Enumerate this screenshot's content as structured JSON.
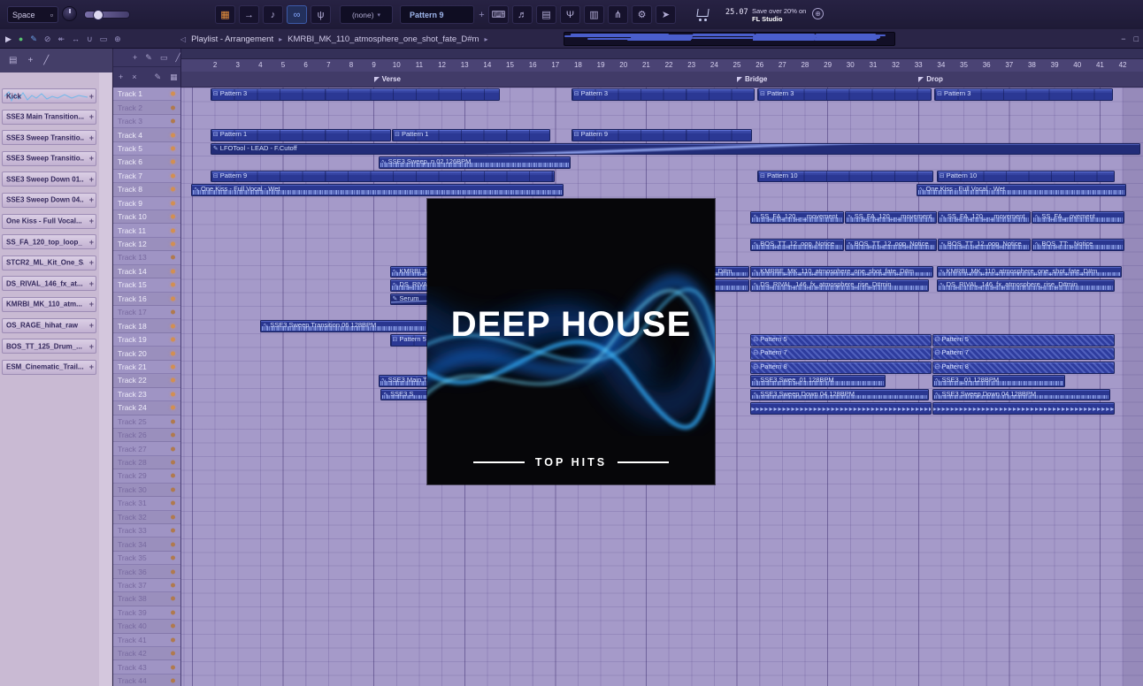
{
  "titlebar": {
    "space": "Space",
    "space_icon_glyph": "▫",
    "tool_icons": [
      {
        "name": "pattern-grid-icon",
        "glyph": "▦",
        "accent": true
      },
      {
        "name": "arrow-right-icon",
        "glyph": "→"
      },
      {
        "name": "note-icon",
        "glyph": "♪"
      },
      {
        "name": "link-icon",
        "glyph": "∞",
        "active": true
      },
      {
        "name": "mic-icon",
        "glyph": "ψ"
      }
    ],
    "instrument_selector": "(none)",
    "selector_caret": "▾",
    "pattern_selector": "Pattern 9",
    "pattern_add": "+",
    "right_icons": [
      {
        "name": "keyboard-icon",
        "glyph": "⌨"
      },
      {
        "name": "notes-icon",
        "glyph": "♬"
      },
      {
        "name": "grid-icon",
        "glyph": "▤"
      },
      {
        "name": "metronome-icon",
        "glyph": "Ψ"
      },
      {
        "name": "panels-icon",
        "glyph": "▥"
      },
      {
        "name": "splitter-icon",
        "glyph": "⋔"
      },
      {
        "name": "gear-icon",
        "glyph": "⚙"
      },
      {
        "name": "pointer-icon",
        "glyph": "➤"
      }
    ],
    "globe_glyph": "⊕",
    "time": "25.07",
    "promo_line1": "Save over 20% on",
    "promo_line2": "FL Studio"
  },
  "toolbar2": {
    "left_icons": [
      {
        "name": "play-icon",
        "glyph": "▶",
        "color": "#cfcae8"
      },
      {
        "name": "record-dot-icon",
        "glyph": "●",
        "color": "#58c470"
      },
      {
        "name": "draw-icon",
        "glyph": "✎",
        "color": "#6aa0e8"
      },
      {
        "name": "slip-icon",
        "glyph": "⊘",
        "color": "#9a93c4"
      },
      {
        "name": "rewind-icon",
        "glyph": "↞",
        "color": "#9a93c4"
      },
      {
        "name": "pan-icon",
        "glyph": "↔",
        "color": "#9a93c4"
      },
      {
        "name": "magnet-icon",
        "glyph": "∪",
        "color": "#9a93c4"
      },
      {
        "name": "select-icon",
        "glyph": "▭",
        "color": "#9a93c4"
      },
      {
        "name": "zoom-icon",
        "glyph": "⊕",
        "color": "#9a93c4"
      }
    ],
    "speaker_glyph": "◁",
    "breadcrumb": "Playlist - Arrangement",
    "sep": "▸",
    "file": "KMRBI_MK_110_atmosphere_one_shot_fate_D#m",
    "minimize": "−",
    "restore": "□"
  },
  "browser": {
    "toolbar_icons": [
      {
        "name": "menu-icon",
        "glyph": "▤"
      },
      {
        "name": "add-icon",
        "glyph": "+"
      },
      {
        "name": "filter-icon",
        "glyph": "╱"
      }
    ],
    "handle_glyph": "+",
    "items": [
      {
        "label": "Kick",
        "waveform": true
      },
      {
        "label": "SSE3 Main Transition...",
        "waveform": false
      },
      {
        "label": "SSE3 Sweep Transitio...",
        "waveform": false
      },
      {
        "label": "SSE3 Sweep Transitio...",
        "waveform": false
      },
      {
        "label": "SSE3 Sweep Down 01...",
        "waveform": false
      },
      {
        "label": "SSE3 Sweep Down 04...",
        "waveform": false
      },
      {
        "label": "One Kiss - Full Vocal...",
        "waveform": false
      },
      {
        "label": "SS_FA_120_top_loop_",
        "waveform": false
      },
      {
        "label": "STCR2_ML_Kit_One_S...",
        "waveform": false
      },
      {
        "label": "DS_RIVAL_146_fx_at...",
        "waveform": false
      },
      {
        "label": "KMRBI_MK_110_atm...",
        "waveform": false
      },
      {
        "label": "OS_RAGE_hihat_raw",
        "waveform": false
      },
      {
        "label": "BOS_TT_125_Drum_...",
        "waveform": false
      },
      {
        "label": "ESM_Cinematic_Trail...",
        "waveform": false
      }
    ]
  },
  "playlist_tools": {
    "icons": [
      {
        "name": "select-tool-icon",
        "glyph": "+"
      },
      {
        "name": "draw-tool-icon",
        "glyph": "✎"
      },
      {
        "name": "paint-tool-icon",
        "glyph": "▭"
      },
      {
        "name": "slice-tool-icon",
        "glyph": "╱"
      }
    ]
  },
  "track_header": {
    "icons_left": [
      {
        "name": "add-track-icon",
        "glyph": "+"
      },
      {
        "name": "delete-track-icon",
        "glyph": "×"
      }
    ],
    "icons_right": [
      {
        "name": "pencil-icon",
        "glyph": "✎"
      },
      {
        "name": "grid-small-icon",
        "glyph": "▦"
      }
    ]
  },
  "timeline": {
    "first_bar": 2,
    "last_bar": 42,
    "markers": [
      {
        "label": "Verse",
        "bar": 9
      },
      {
        "label": "Bridge",
        "bar": 25
      },
      {
        "label": "Drop",
        "bar": 33
      }
    ]
  },
  "clip_icons": {
    "pattern": "⊟",
    "pattern-dim": "⊟",
    "audio": "∿",
    "automation": "✎",
    "chopped": ""
  },
  "chop_glyph": "▸",
  "tracks": [
    {
      "name": "Track 1",
      "active": true
    },
    {
      "name": "Track 2",
      "active": false
    },
    {
      "name": "Track 3",
      "active": false
    },
    {
      "name": "Track 4",
      "active": true
    },
    {
      "name": "Track 5",
      "active": true
    },
    {
      "name": "Track 6",
      "active": true
    },
    {
      "name": "Track 7",
      "active": true
    },
    {
      "name": "Track 8",
      "active": true
    },
    {
      "name": "Track 9",
      "active": true
    },
    {
      "name": "Track 10",
      "active": true
    },
    {
      "name": "Track 11",
      "active": true
    },
    {
      "name": "Track 12",
      "active": true
    },
    {
      "name": "Track 13",
      "active": false
    },
    {
      "name": "Track 14",
      "active": true
    },
    {
      "name": "Track 15",
      "active": true
    },
    {
      "name": "Track 16",
      "active": true
    },
    {
      "name": "Track 17",
      "active": false
    },
    {
      "name": "Track 18",
      "active": true
    },
    {
      "name": "Track 19",
      "active": true
    },
    {
      "name": "Track 20",
      "active": true
    },
    {
      "name": "Track 21",
      "active": true
    },
    {
      "name": "Track 22",
      "active": true
    },
    {
      "name": "Track 23",
      "active": true
    },
    {
      "name": "Track 24",
      "active": true
    },
    {
      "name": "Track 25",
      "active": false
    },
    {
      "name": "Track 26",
      "active": false
    },
    {
      "name": "Track 27",
      "active": false
    },
    {
      "name": "Track 28",
      "active": false
    },
    {
      "name": "Track 29",
      "active": false
    },
    {
      "name": "Track 30",
      "active": false
    },
    {
      "name": "Track 31",
      "active": false
    },
    {
      "name": "Track 32",
      "active": false
    },
    {
      "name": "Track 33",
      "active": false
    },
    {
      "name": "Track 34",
      "active": false
    },
    {
      "name": "Track 35",
      "active": false
    },
    {
      "name": "Track 36",
      "active": false
    },
    {
      "name": "Track 37",
      "active": false
    },
    {
      "name": "Track 38",
      "active": false
    },
    {
      "name": "Track 39",
      "active": false
    },
    {
      "name": "Track 40",
      "active": false
    },
    {
      "name": "Track 41",
      "active": false
    },
    {
      "name": "Track 42",
      "active": false
    },
    {
      "name": "Track 43",
      "active": false
    },
    {
      "name": "Track 44",
      "active": false
    }
  ],
  "clips": [
    {
      "track": 1,
      "start": 1.8,
      "end": 14.6,
      "label": "Pattern 3",
      "kind": "pattern"
    },
    {
      "track": 1,
      "start": 17.7,
      "end": 25.8,
      "label": "Pattern 3",
      "kind": "pattern"
    },
    {
      "track": 1,
      "start": 25.9,
      "end": 33.6,
      "label": "Pattern 3",
      "kind": "pattern"
    },
    {
      "track": 1,
      "start": 33.7,
      "end": 41.6,
      "label": "Pattern 3",
      "kind": "pattern"
    },
    {
      "track": 4,
      "start": 1.8,
      "end": 9.8,
      "label": "Pattern 1",
      "kind": "pattern"
    },
    {
      "track": 4,
      "start": 9.8,
      "end": 16.8,
      "label": "Pattern 1",
      "kind": "pattern"
    },
    {
      "track": 4,
      "start": 17.7,
      "end": 25.7,
      "label": "Pattern 9",
      "kind": "pattern"
    },
    {
      "track": 5,
      "start": 1.8,
      "end": 42.8,
      "label": "LFOTool - LEAD - F.Cutoff",
      "kind": "automation"
    },
    {
      "track": 6,
      "start": 9.2,
      "end": 17.7,
      "label": "SSE3 Sweep..n 02 126BPM",
      "kind": "audio"
    },
    {
      "track": 7,
      "start": 1.8,
      "end": 17.0,
      "label": "Pattern 9",
      "kind": "pattern"
    },
    {
      "track": 7,
      "start": 25.9,
      "end": 33.7,
      "label": "Pattern 10",
      "kind": "pattern"
    },
    {
      "track": 7,
      "start": 33.8,
      "end": 41.7,
      "label": "Pattern 10",
      "kind": "pattern"
    },
    {
      "track": 8,
      "start": 0.95,
      "end": 17.4,
      "label": "One Kiss - Full Vocal - Wet",
      "kind": "audio"
    },
    {
      "track": 8,
      "start": 32.9,
      "end": 42.2,
      "label": "One Kiss - Full Vocal - Wet",
      "kind": "audio"
    },
    {
      "track": 10,
      "start": 25.6,
      "end": 29.75,
      "label": "SS_FA_120_.._movement",
      "kind": "audio"
    },
    {
      "track": 10,
      "start": 29.75,
      "end": 33.85,
      "label": "SS_FA_120_.._movement",
      "kind": "audio"
    },
    {
      "track": 10,
      "start": 33.85,
      "end": 38.0,
      "label": "SS_FA_120_.._movement",
      "kind": "audio"
    },
    {
      "track": 10,
      "start": 38.0,
      "end": 42.1,
      "label": "SS_FA_..ovement",
      "kind": "audio"
    },
    {
      "track": 12,
      "start": 25.6,
      "end": 29.75,
      "label": "BOS_TT_12..oop_Notice",
      "kind": "audio"
    },
    {
      "track": 12,
      "start": 29.75,
      "end": 33.85,
      "label": "BOS_TT_12..oop_Notice",
      "kind": "audio"
    },
    {
      "track": 12,
      "start": 33.85,
      "end": 38.0,
      "label": "BOS_TT_12..oop_Notice",
      "kind": "audio"
    },
    {
      "track": 12,
      "start": 38.0,
      "end": 42.1,
      "label": "BOS_TT:._Notice",
      "kind": "audio"
    },
    {
      "track": 14,
      "start": 9.7,
      "end": 17.7,
      "label": "KMRBI_MK_110_atmosphere_one_shot_fate_D#m",
      "kind": "audio"
    },
    {
      "track": 14,
      "start": 17.7,
      "end": 25.6,
      "label": "KMRBI_MK_110_atmosphere_one_shot_fate_D#m",
      "kind": "audio"
    },
    {
      "track": 14,
      "start": 25.6,
      "end": 33.7,
      "label": "KMRBE_MK_110_atmosphere_one_shot_fate_D#m",
      "kind": "audio"
    },
    {
      "track": 14,
      "start": 33.8,
      "end": 42.0,
      "label": "KMRBI_MK_110_atmosphere_one_shot_fate_D#m",
      "kind": "audio"
    },
    {
      "track": 15,
      "start": 9.7,
      "end": 17.7,
      "label": "DS_RIVAL_146_fx_atmosphere_rise_D#min",
      "kind": "audio"
    },
    {
      "track": 15,
      "start": 17.7,
      "end": 25.6,
      "label": "DS_RIVAL_146_fx_atmosphere_rise_D#min",
      "kind": "audio"
    },
    {
      "track": 15,
      "start": 25.6,
      "end": 33.5,
      "label": "DS_RIVAL_146_fx_atmosphere_rise_D#min",
      "kind": "audio"
    },
    {
      "track": 15,
      "start": 33.8,
      "end": 41.7,
      "label": "DS_RIVAL_146_fx_atmosphere_rise_D#min",
      "kind": "audio"
    },
    {
      "track": 16,
      "start": 9.7,
      "end": 17.5,
      "label": "Serum",
      "kind": "automation"
    },
    {
      "track": 18,
      "start": 4.0,
      "end": 11.4,
      "label": "SSE3 Sweep Transition 06 128BPM",
      "kind": "audio"
    },
    {
      "track": 19,
      "start": 9.7,
      "end": 17.6,
      "label": "Pattern 5",
      "kind": "pattern"
    },
    {
      "track": 19,
      "start": 25.6,
      "end": 33.6,
      "label": "Pattern 5",
      "kind": "pattern-dim"
    },
    {
      "track": 19,
      "start": 33.6,
      "end": 41.7,
      "label": "Pattern 5",
      "kind": "pattern-dim"
    },
    {
      "track": 20,
      "start": 25.6,
      "end": 33.6,
      "label": "Pattern 7",
      "kind": "pattern-dim"
    },
    {
      "track": 20,
      "start": 33.6,
      "end": 41.7,
      "label": "Pattern 7",
      "kind": "pattern-dim"
    },
    {
      "track": 21,
      "start": 25.6,
      "end": 33.6,
      "label": "Pattern 8",
      "kind": "pattern-dim"
    },
    {
      "track": 21,
      "start": 33.6,
      "end": 41.7,
      "label": "Pattern 8",
      "kind": "pattern-dim"
    },
    {
      "track": 22,
      "start": 9.2,
      "end": 17.5,
      "label": "SSE3 Main Tr",
      "kind": "audio"
    },
    {
      "track": 22,
      "start": 25.6,
      "end": 31.6,
      "label": "SSE3 Swee_01 128BPM",
      "kind": "audio"
    },
    {
      "track": 22,
      "start": 33.6,
      "end": 39.5,
      "label": "SSE3 _01 128BPM",
      "kind": "audio"
    },
    {
      "track": 23,
      "start": 9.3,
      "end": 17.5,
      "label": "SSE3 S",
      "kind": "audio"
    },
    {
      "track": 23,
      "start": 25.6,
      "end": 33.5,
      "label": "SSE3 Sweep Down 04 128BPM",
      "kind": "audio"
    },
    {
      "track": 23,
      "start": 33.6,
      "end": 41.5,
      "label": "SSE3 Sweep Down 04 128BPM",
      "kind": "audio"
    },
    {
      "track": 24,
      "start": 25.6,
      "end": 33.6,
      "label": "",
      "kind": "chopped"
    },
    {
      "track": 24,
      "start": 33.6,
      "end": 41.7,
      "label": "",
      "kind": "chopped"
    }
  ],
  "overlay": {
    "title": "DEEP HOUSE",
    "subtitle": "TOP HITS"
  }
}
